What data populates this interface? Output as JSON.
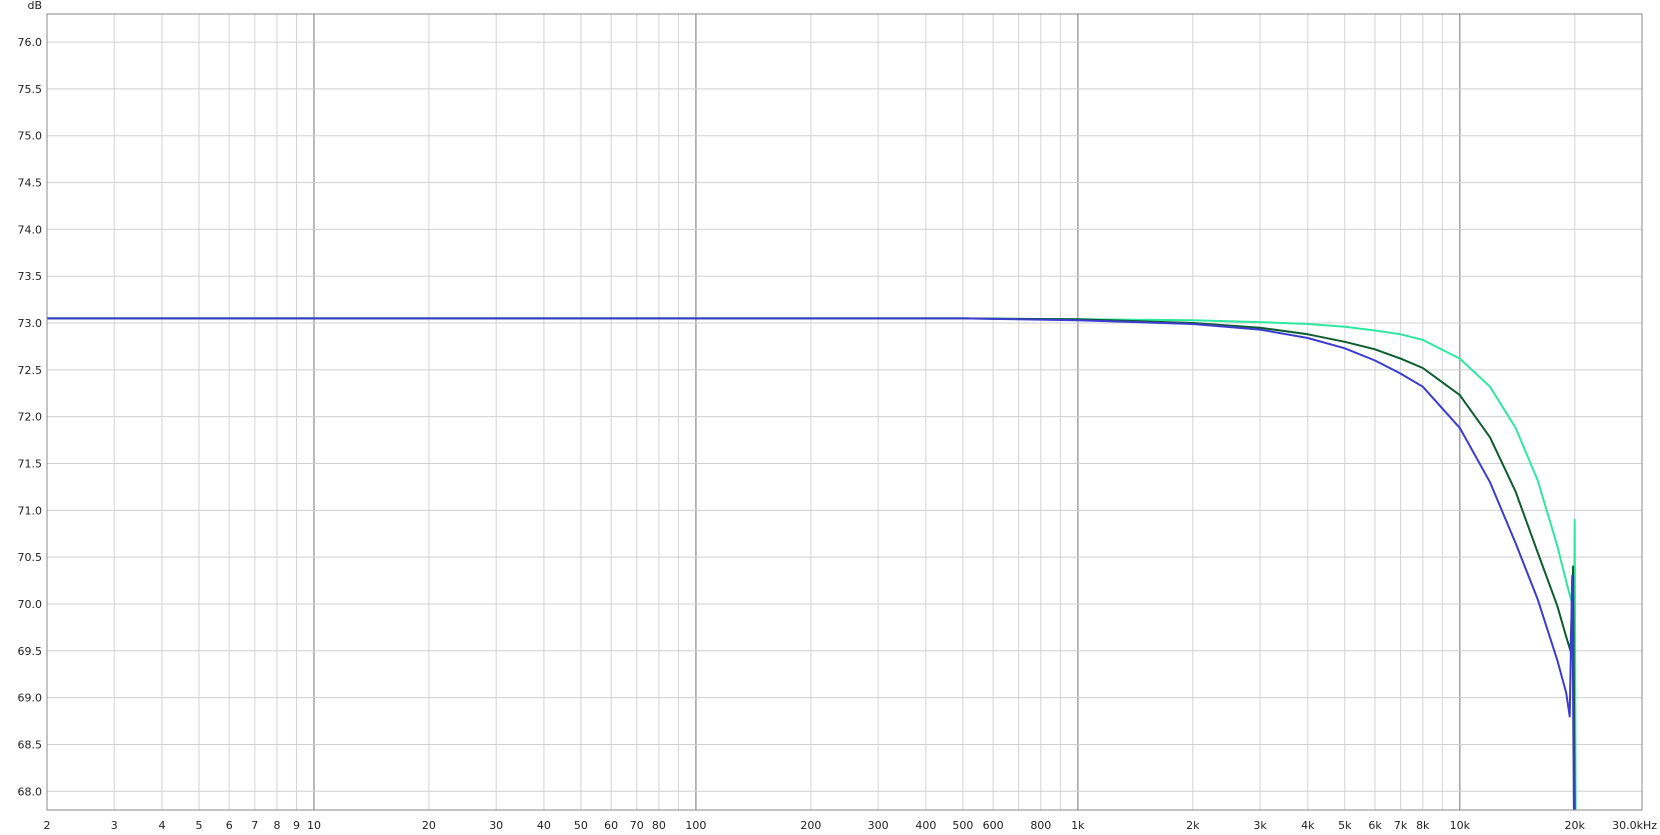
{
  "chart_data": {
    "type": "line",
    "x_scale": "log",
    "xlim": [
      2,
      30000
    ],
    "ylim": [
      67.8,
      76.3
    ],
    "grid": true,
    "ylabel": "dB",
    "xunit": "Hz",
    "xticks": [
      {
        "v": 2,
        "label": "2"
      },
      {
        "v": 3,
        "label": "3"
      },
      {
        "v": 4,
        "label": "4"
      },
      {
        "v": 5,
        "label": "5"
      },
      {
        "v": 6,
        "label": "6"
      },
      {
        "v": 7,
        "label": "7"
      },
      {
        "v": 8,
        "label": "8"
      },
      {
        "v": 9,
        "label": "9"
      },
      {
        "v": 10,
        "label": "10"
      },
      {
        "v": 20,
        "label": "20"
      },
      {
        "v": 30,
        "label": "30"
      },
      {
        "v": 40,
        "label": "40"
      },
      {
        "v": 50,
        "label": "50"
      },
      {
        "v": 60,
        "label": "60"
      },
      {
        "v": 70,
        "label": "70"
      },
      {
        "v": 80,
        "label": "80"
      },
      {
        "v": 100,
        "label": "100"
      },
      {
        "v": 200,
        "label": "200"
      },
      {
        "v": 300,
        "label": "300"
      },
      {
        "v": 400,
        "label": "400"
      },
      {
        "v": 500,
        "label": "500"
      },
      {
        "v": 600,
        "label": "600"
      },
      {
        "v": 800,
        "label": "800"
      },
      {
        "v": 1000,
        "label": "1k"
      },
      {
        "v": 2000,
        "label": "2k"
      },
      {
        "v": 3000,
        "label": "3k"
      },
      {
        "v": 4000,
        "label": "4k"
      },
      {
        "v": 5000,
        "label": "5k"
      },
      {
        "v": 6000,
        "label": "6k"
      },
      {
        "v": 7000,
        "label": "7k"
      },
      {
        "v": 8000,
        "label": "8k"
      },
      {
        "v": 10000,
        "label": "10k"
      },
      {
        "v": 20000,
        "label": "20k"
      },
      {
        "v": 30000,
        "label": "30.0kHz"
      }
    ],
    "yticks": [
      76.0,
      75.5,
      75.0,
      74.5,
      74.0,
      73.5,
      73.0,
      72.5,
      72.0,
      71.5,
      71.0,
      70.5,
      70.0,
      69.5,
      69.0,
      68.5,
      68.0
    ],
    "series": [
      {
        "color": "#2ee8a0",
        "x": [
          2,
          100,
          500,
          1000,
          2000,
          3000,
          4000,
          5000,
          6000,
          7000,
          8000,
          10000,
          12000,
          14000,
          16000,
          18000,
          19000,
          19700,
          19900,
          20000,
          20100
        ],
        "y": [
          73.05,
          73.05,
          73.05,
          73.04,
          73.03,
          73.01,
          72.99,
          72.96,
          72.92,
          72.88,
          72.82,
          72.62,
          72.32,
          71.88,
          71.32,
          70.62,
          70.24,
          70.0,
          69.5,
          70.9,
          67.8
        ]
      },
      {
        "color": "#0d5c2e",
        "x": [
          2,
          100,
          500,
          1000,
          2000,
          3000,
          4000,
          5000,
          6000,
          7000,
          8000,
          10000,
          12000,
          14000,
          16000,
          18000,
          19000,
          19500,
          19800,
          20000
        ],
        "y": [
          73.05,
          73.05,
          73.05,
          73.04,
          73.0,
          72.95,
          72.88,
          72.8,
          72.72,
          72.62,
          72.52,
          72.23,
          71.78,
          71.2,
          70.55,
          69.98,
          69.65,
          69.5,
          70.4,
          67.8
        ]
      },
      {
        "color": "#3c3cd0",
        "x": [
          2,
          100,
          500,
          1000,
          2000,
          3000,
          4000,
          5000,
          6000,
          7000,
          8000,
          10000,
          12000,
          14000,
          16000,
          18000,
          19000,
          19400,
          19700,
          19900
        ],
        "y": [
          73.05,
          73.05,
          73.05,
          73.03,
          72.99,
          72.93,
          72.84,
          72.73,
          72.6,
          72.46,
          72.32,
          71.88,
          71.3,
          70.65,
          70.05,
          69.4,
          69.05,
          68.8,
          70.3,
          67.8
        ]
      }
    ]
  }
}
